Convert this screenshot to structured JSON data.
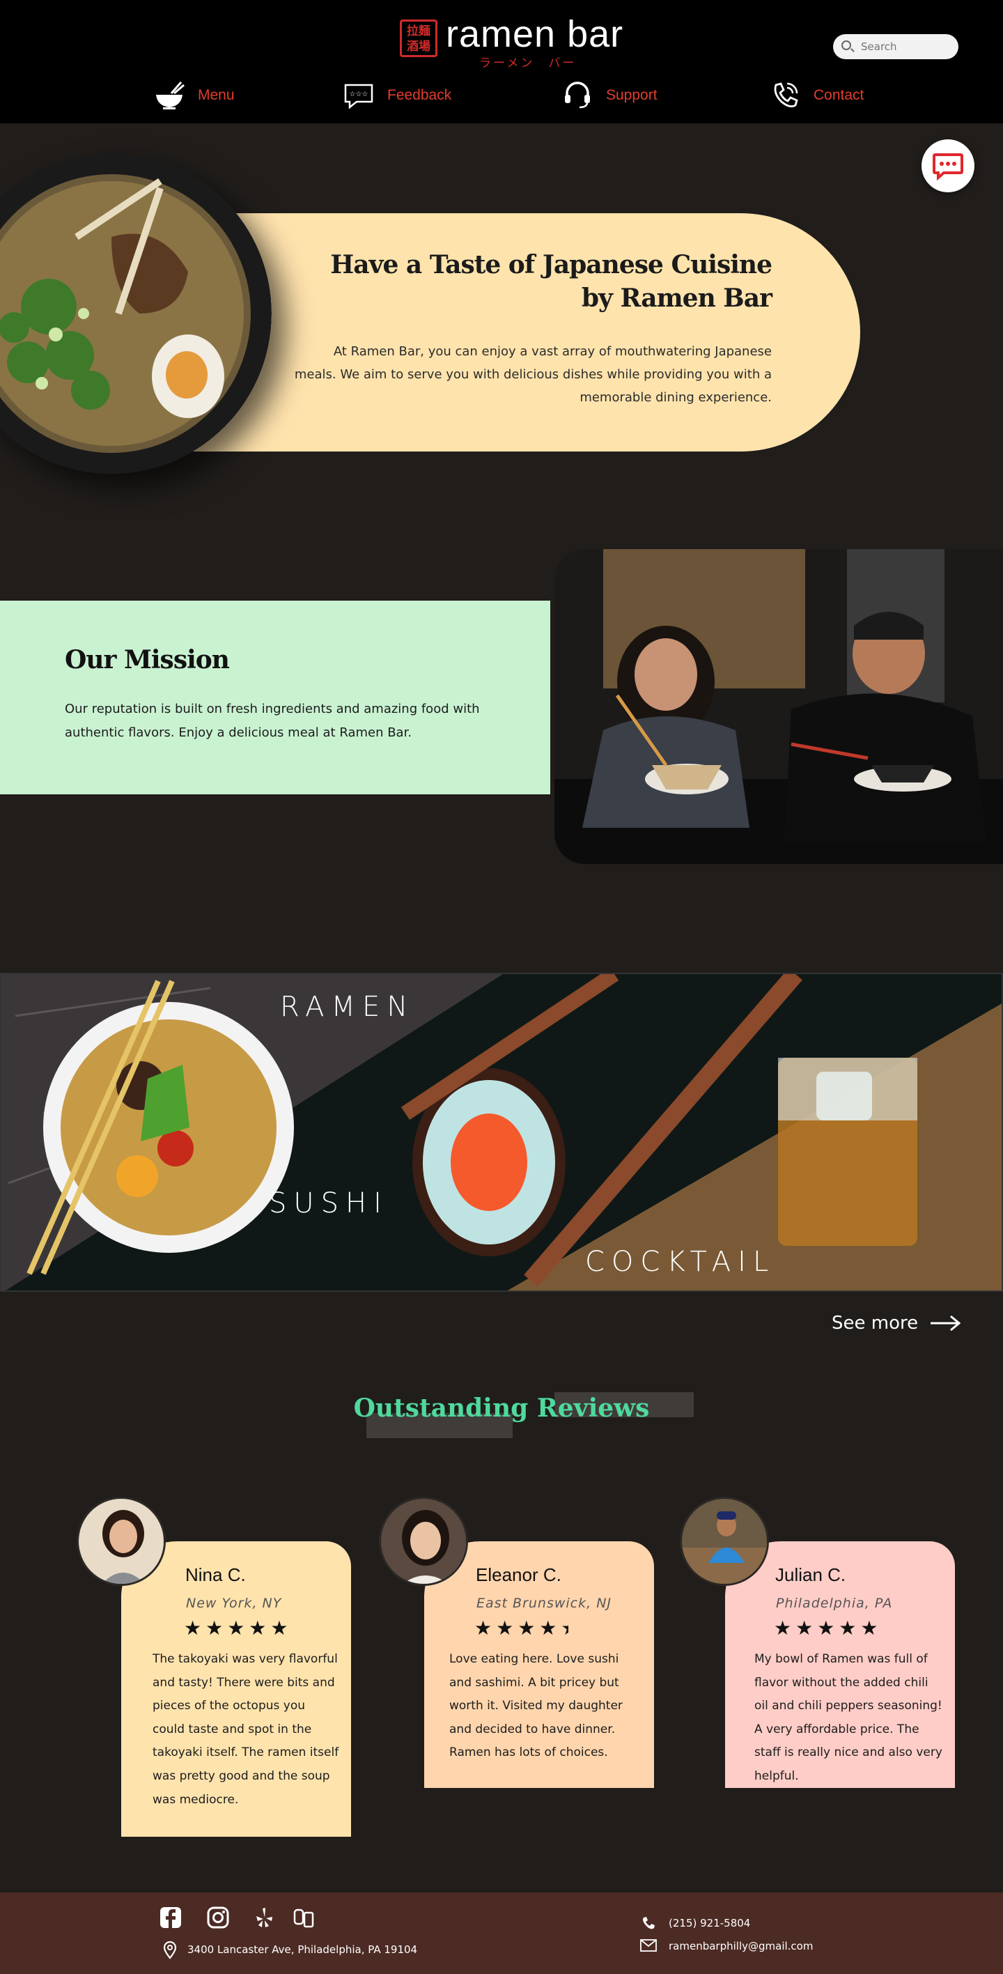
{
  "header": {
    "logo": {
      "kanji": "拉麺\n酒場",
      "name": "ramen bar",
      "subtitle": "ラーメン　バー"
    },
    "search": {
      "placeholder": "Search"
    },
    "nav": [
      {
        "label": "Menu",
        "icon": "ramen-bowl-icon"
      },
      {
        "label": "Feedback",
        "icon": "rating-stars-icon"
      },
      {
        "label": "Support",
        "icon": "headset-icon"
      },
      {
        "label": "Contact",
        "icon": "phone-icon"
      }
    ]
  },
  "hero": {
    "title_line1": "Have a Taste of Japanese Cuisine",
    "title_line2": "by Ramen Bar",
    "body": "At Ramen Bar, you can enjoy a vast array of mouthwatering Japanese meals. We aim to serve you with delicious dishes while providing you with a memorable dining experience."
  },
  "mission": {
    "title": "Our Mission",
    "body": "Our reputation is built on fresh ingredients and amazing food with authentic flavors. Enjoy a delicious meal at Ramen Bar."
  },
  "banner": {
    "labels": [
      "RAMEN",
      "SUSHI",
      "COCKTAIL"
    ]
  },
  "see_more": "See more",
  "reviews": {
    "title": "Outstanding Reviews",
    "items": [
      {
        "name": "Nina C.",
        "location": "New York, NY",
        "stars": "★★★★★",
        "rating": 5,
        "text": "The takoyaki was very flavorful and tasty! There were bits and pieces of the octopus you could taste and spot in the takoyaki itself. The ramen itself was pretty good and the soup was mediocre.",
        "color": "#ffe3ad"
      },
      {
        "name": "Eleanor C.",
        "location": "East Brunswick, NJ",
        "stars": "★★★★",
        "rating": 4.5,
        "text": "Love eating here. Love sushi and sashimi. A bit pricey but worth it. Visited my daughter and decided to have dinner. Ramen has lots of choices.",
        "color": "#ffd5ad"
      },
      {
        "name": "Julian C.",
        "location": "Philadelphia, PA",
        "stars": "★★★★★",
        "rating": 5,
        "text": "My bowl of Ramen was full of flavor without the added chili oil and chili peppers seasoning! A very affordable price. The staff is really nice and also very helpful.",
        "color": "#ffcdc7"
      }
    ]
  },
  "footer": {
    "social": [
      "facebook-icon",
      "instagram-icon",
      "yelp-icon",
      "grubhub-icon"
    ],
    "address": "3400 Lancaster Ave, Philadelphia, PA 19104",
    "phone": "(215) 921-5804",
    "email": "ramenbarphilly@gmail.com"
  },
  "colors": {
    "accent_red": "#e23d2e",
    "hero_card": "#ffe3ad",
    "mission_card": "#c9f2d1",
    "reviews_title": "#4fd99d",
    "footer": "#4c2b24"
  }
}
